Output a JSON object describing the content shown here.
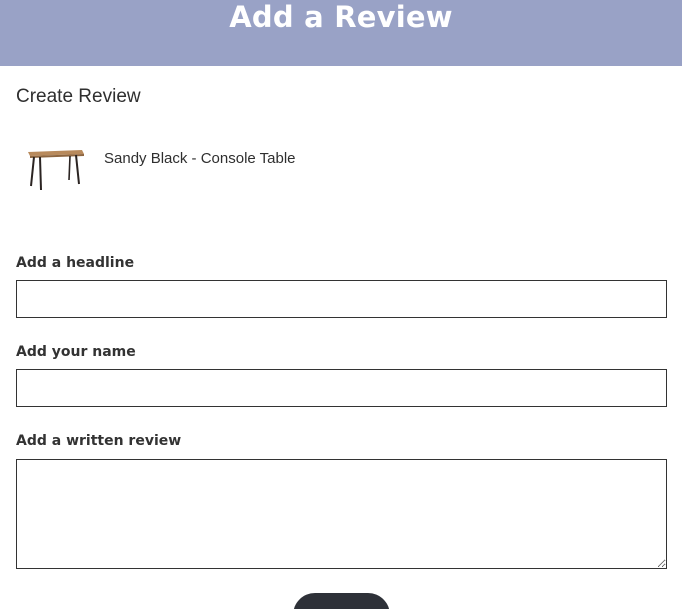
{
  "header": {
    "title": "Add a Review"
  },
  "form": {
    "section_title": "Create Review",
    "product": {
      "name": "Sandy Black - Console Table",
      "thumbnail_icon": "console-table-thumbnail"
    },
    "fields": {
      "headline": {
        "label": "Add a headline",
        "value": ""
      },
      "name": {
        "label": "Add your name",
        "value": ""
      },
      "review": {
        "label": "Add a written review",
        "value": ""
      }
    },
    "submit_label": ""
  },
  "colors": {
    "header_bg": "#99a2c6",
    "header_text": "#ffffff",
    "button_bg": "#2e3138",
    "input_border": "#333333"
  }
}
